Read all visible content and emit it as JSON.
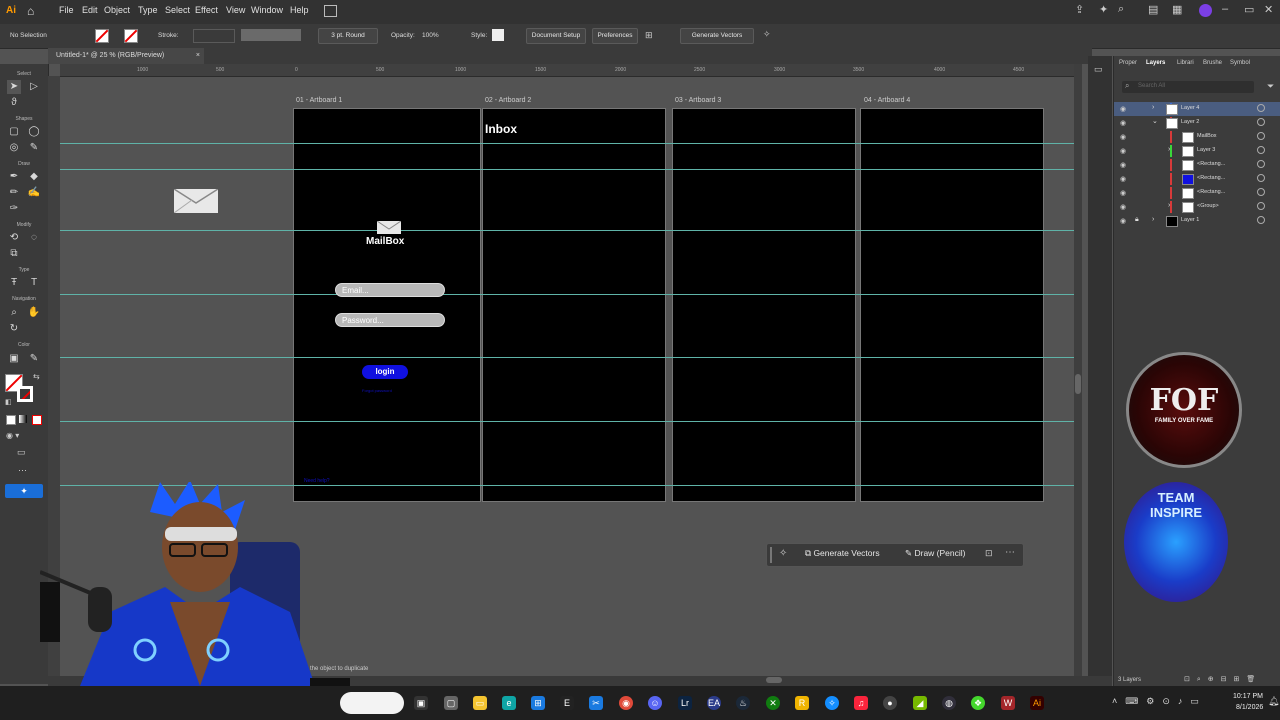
{
  "menubar": {
    "app_logo": "Ai",
    "items": [
      "File",
      "Edit",
      "Object",
      "Type",
      "Select",
      "Effect",
      "View",
      "Window",
      "Help"
    ]
  },
  "controlbar": {
    "selection": "No Selection",
    "stroke_label": "Stroke:",
    "brush": "3 pt. Round",
    "opacity_label": "Opacity:",
    "opacity_value": "100%",
    "style_label": "Style:",
    "document_setup": "Document Setup",
    "preferences": "Preferences",
    "generate_vectors": "Generate Vectors"
  },
  "tab": {
    "title": "Untitled-1* @ 25 % (RGB/Preview)",
    "close": "×"
  },
  "toolbar": {
    "sections": [
      "Select",
      "Shapes",
      "Draw",
      "Modify",
      "Type",
      "Navigation",
      "Color"
    ]
  },
  "ruler": {
    "h_ticks": [
      "1000",
      "500",
      "0",
      "500",
      "1000",
      "1500",
      "2000",
      "2500",
      "3000",
      "3500",
      "4000",
      "4500"
    ]
  },
  "artboards": [
    {
      "label": "01 - Artboard 1"
    },
    {
      "label": "02 - Artboard 2"
    },
    {
      "label": "03 - Artboard 3"
    },
    {
      "label": "04 - Artboard 4"
    }
  ],
  "login": {
    "app_name": "MailBox",
    "email_placeholder": "Email...",
    "password_placeholder": "Password...",
    "login_button": "login",
    "forgot": "Forgot password",
    "footer": "Need help?"
  },
  "inbox": {
    "title": "Inbox"
  },
  "contextbar": {
    "generate_vectors": "Generate Vectors",
    "draw_pencil": "Draw (Pencil)"
  },
  "panel": {
    "tabs": [
      "Proper",
      "Layers",
      "Librari",
      "Brushe",
      "Symbol"
    ],
    "search_placeholder": "Search All",
    "layers": [
      {
        "name": "Layer 4",
        "indent": 0,
        "selected": true
      },
      {
        "name": "Layer 2",
        "indent": 0,
        "selected": false
      },
      {
        "name": "MailBox",
        "indent": 2,
        "selected": false
      },
      {
        "name": "Layer 3",
        "indent": 1,
        "selected": false
      },
      {
        "name": "<Rectang...",
        "indent": 2,
        "selected": false
      },
      {
        "name": "<Rectang...",
        "indent": 2,
        "selected": false
      },
      {
        "name": "<Rectang...",
        "indent": 2,
        "selected": false
      },
      {
        "name": "<Group>",
        "indent": 1,
        "selected": false
      },
      {
        "name": "Layer 1",
        "indent": 0,
        "selected": false
      }
    ],
    "layers_count": "3 Layers"
  },
  "status": {
    "hint": "the object to duplicate"
  },
  "taskbar": {
    "time": "10:17 PM",
    "date": "8/1/2026"
  },
  "overlays": {
    "logo1_lines": [
      "FOF",
      "FAMILY OVER FAME"
    ],
    "logo2_lines": [
      "TEAM",
      "INSPIRE"
    ]
  },
  "colors": {
    "accent_blue": "#1010e0",
    "guide": "#5fb3a8",
    "layer4": "#3a6bd8",
    "layer2": "#d83a3a",
    "layer3": "#3ad83a"
  }
}
